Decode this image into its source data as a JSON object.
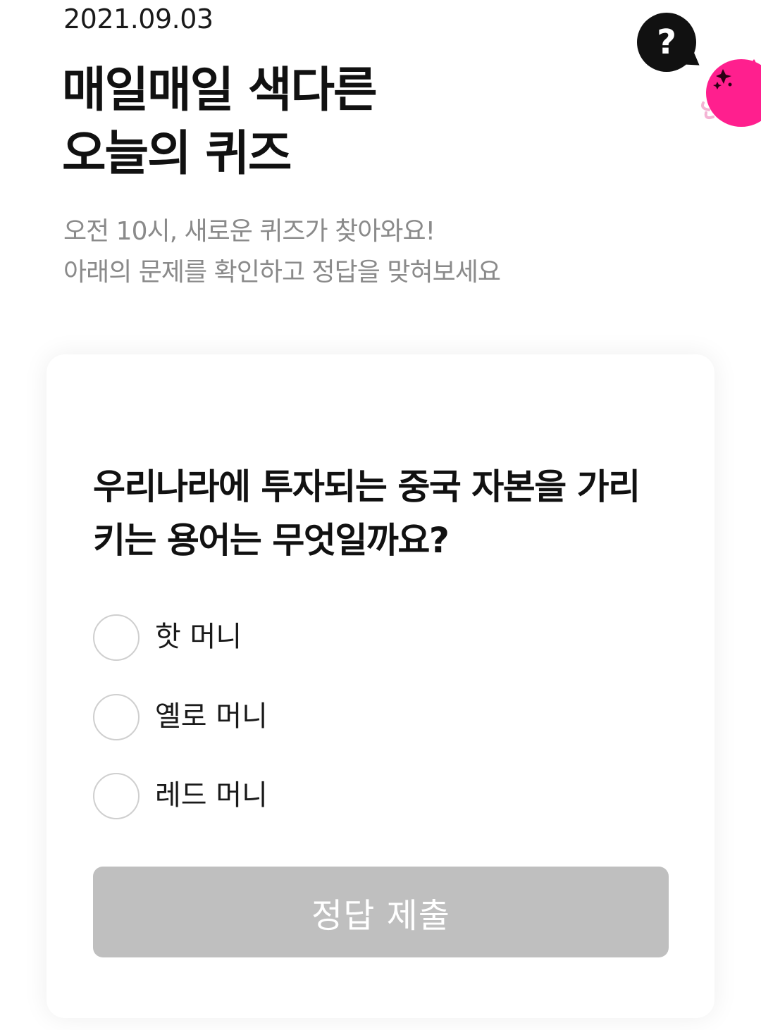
{
  "header": {
    "date": "2021.09.03",
    "title_lines": [
      "매일매일 색다른",
      "오늘의 퀴즈"
    ],
    "subtitle_lines": [
      "오전 10시, 새로운 퀴즈가 찾아와요!",
      "아래의 문제를 확인하고 정답을 맞혀보세요"
    ],
    "help_icon": "question-mark-icon",
    "help_label": "?",
    "mascot_icon": "pink-character-mascot"
  },
  "quiz": {
    "question_lines": [
      "우리나라에 투자되는 중국 자본을 가리",
      "키는 용어는 무엇일까요?"
    ],
    "options": [
      {
        "label": "핫 머니",
        "selected": false
      },
      {
        "label": "옐로 머니",
        "selected": false
      },
      {
        "label": "레드 머니",
        "selected": false
      }
    ],
    "submit_label": "정답 제출",
    "submit_enabled": false
  },
  "colors": {
    "accent_pink": "#ff1f8e",
    "button_disabled": "#bfbfbf",
    "subtitle_gray": "#8a8a8a",
    "radio_border": "#cfcfcf"
  }
}
